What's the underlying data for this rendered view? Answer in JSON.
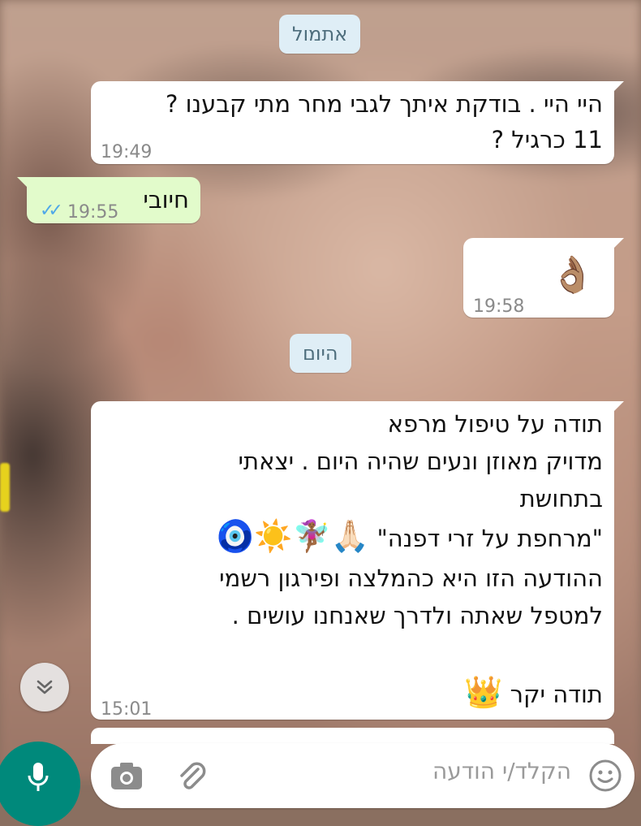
{
  "chat": {
    "date_yesterday": "אתמול",
    "date_today": "היום",
    "msg1": {
      "lines": [
        "היי היי . בודקת איתך לגבי מחר מתי קבענו ?",
        "11 כרגיל ?"
      ],
      "time": "19:49"
    },
    "msg2": {
      "text": "חיובי",
      "time": "19:55",
      "status": "read-double-check"
    },
    "msg3": {
      "emoji": "👌🏽",
      "time": "19:58"
    },
    "msg4": {
      "lines": [
        "תודה על טיפול מרפא",
        "מדויק מאוזן ונעים שהיה היום . יצאתי",
        "בתחושת",
        "\"מרחפת על זרי דפנה\"",
        "ההודעה הזו היא כהמלצה ופירגון רשמי",
        "למטפל שאתה ולדרך שאנחנו עושים ."
      ],
      "emoji_line": "🙏🏻🧚🏾‍♀️☀️🧿",
      "closing": "תודה יקר",
      "closing_emoji": "👑",
      "time": "15:01"
    }
  },
  "composer": {
    "placeholder": "הקלד/י הודעה",
    "icons": [
      "emoji-icon",
      "attach-icon",
      "camera-icon",
      "mic-icon"
    ]
  },
  "colors": {
    "incoming_bubble": "#ffffff",
    "outgoing_bubble": "#e2fbcb",
    "date_chip": "#dfeef6",
    "read_ticks": "#4fa8e8",
    "mic_button": "#00897b"
  }
}
